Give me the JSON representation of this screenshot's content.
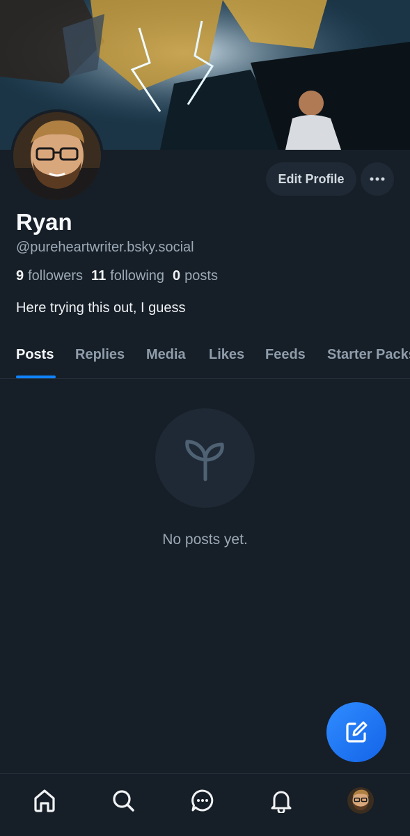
{
  "profile": {
    "name": "Ryan",
    "handle": "@pureheartwriter.bsky.social",
    "followers_count": "9",
    "followers_label": "followers",
    "following_count": "11",
    "following_label": "following",
    "posts_count": "0",
    "posts_label": "posts",
    "bio": "Here trying this out, I guess"
  },
  "header": {
    "edit_profile_label": "Edit Profile",
    "more_icon": "ellipsis-icon"
  },
  "tabs": [
    {
      "label": "Posts",
      "active": true
    },
    {
      "label": "Replies",
      "active": false
    },
    {
      "label": "Media",
      "active": false
    },
    {
      "label": "Likes",
      "active": false
    },
    {
      "label": "Feeds",
      "active": false
    },
    {
      "label": "Starter Packs",
      "active": false
    }
  ],
  "empty_state": {
    "icon": "sprout-icon",
    "message": "No posts yet."
  },
  "fab": {
    "icon": "compose-icon"
  },
  "bottom_nav": [
    {
      "icon": "home-icon"
    },
    {
      "icon": "search-icon"
    },
    {
      "icon": "chat-icon"
    },
    {
      "icon": "bell-icon"
    },
    {
      "icon": "profile-avatar"
    }
  ],
  "colors": {
    "background": "#161e27",
    "accent": "#1083fe",
    "button_bg": "#1e2935",
    "muted_text": "#9ba9b6"
  }
}
